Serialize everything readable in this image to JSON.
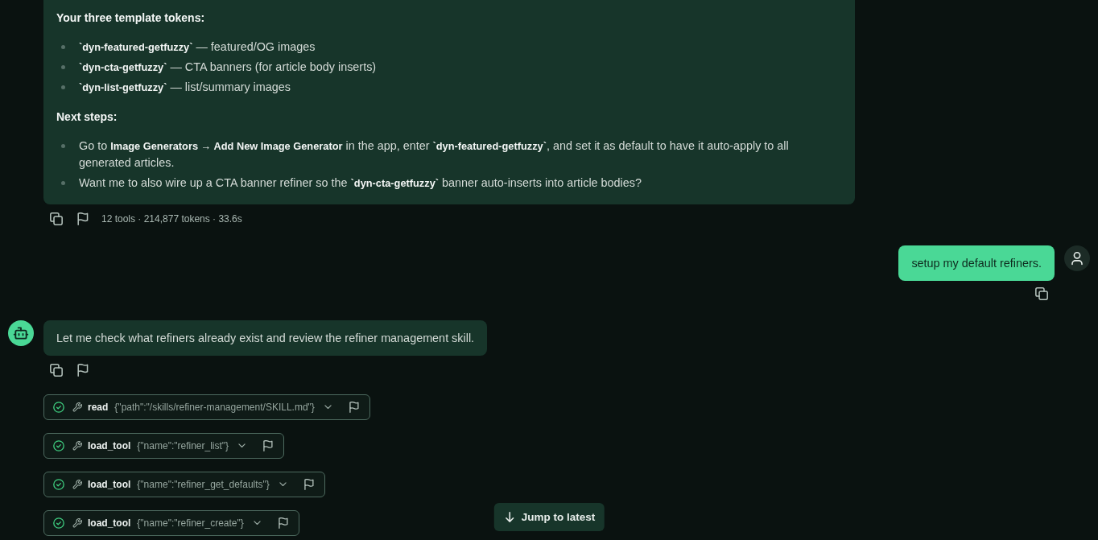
{
  "messages": [
    {
      "kind": "assistant",
      "avatar": false,
      "blocks": [
        {
          "kind": "heading",
          "text": "Your three template tokens:"
        },
        {
          "kind": "list",
          "items": [
            "**`dyn-featured-getfuzzy`** — featured/OG images",
            "**`dyn-cta-getfuzzy`** — CTA banners (for article body inserts)",
            "**`dyn-list-getfuzzy`** — list/summary images"
          ]
        },
        {
          "kind": "heading",
          "text": "Next steps:"
        },
        {
          "kind": "list",
          "items": [
            "Go to **Image Generators → Add New Image Generator** in the app, enter **`dyn-featured-getfuzzy`**, and set it as default to have it auto-apply to all generated articles.",
            "Want me to also wire up a CTA banner refiner so the **`dyn-cta-getfuzzy`** banner auto-inserts into article bodies?"
          ]
        }
      ],
      "stats": "12 tools · 214,877 tokens · 33.6s"
    },
    {
      "kind": "user",
      "avatar": true,
      "blocks": [
        {
          "kind": "paragraph",
          "text": "setup my default refiners."
        }
      ]
    },
    {
      "kind": "assistant",
      "avatar": true,
      "blocks": [
        {
          "kind": "paragraph",
          "text": "Let me check what refiners already exist and review the refiner management skill."
        }
      ],
      "tool_calls": [
        {
          "name": "read",
          "args": "{\"path\":\"/skills/refiner-management/SKILL.md\"}",
          "completed": true,
          "expanded": false
        },
        {
          "name": "load_tool",
          "args": "{\"name\":\"refiner_list\"}",
          "completed": true,
          "expanded": false
        },
        {
          "name": "load_tool",
          "args": "{\"name\":\"refiner_get_defaults\"}",
          "completed": true,
          "expanded": false
        },
        {
          "name": "load_tool",
          "args": "{\"name\":\"refiner_create\"}",
          "completed": true,
          "expanded": false
        }
      ]
    }
  ],
  "jump_button": {
    "label": "Jump to latest"
  }
}
